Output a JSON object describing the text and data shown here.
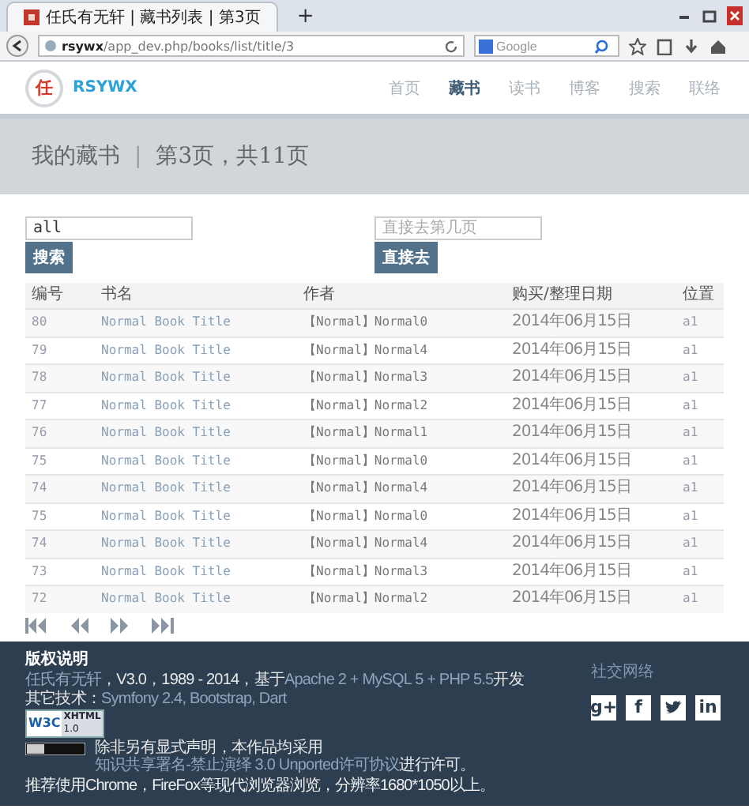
{
  "browser": {
    "tab_title": "任氏有无轩 | 藏书列表 | 第3页",
    "new_tab": "+",
    "url_host": "rsywx",
    "url_path": "/app_dev.php/books/list/title/3",
    "search_placeholder": "Google"
  },
  "nav": {
    "logo": "任",
    "brand": "RSYWX",
    "items": [
      {
        "label": "首页",
        "selected": false
      },
      {
        "label": "藏书",
        "selected": true
      },
      {
        "label": "读书",
        "selected": false
      },
      {
        "label": "博客",
        "selected": false
      },
      {
        "label": "搜索",
        "selected": false
      },
      {
        "label": "联络",
        "selected": false
      }
    ]
  },
  "banner": {
    "title": "我的藏书",
    "separator": "|",
    "subtitle": "第3页，共11页"
  },
  "search": {
    "value": "all",
    "button": "搜索"
  },
  "jump": {
    "placeholder": "直接去第几页",
    "button": "直接去"
  },
  "table": {
    "columns": [
      "编号",
      "书名",
      "作者",
      "购买/整理日期",
      "位置"
    ],
    "rows": [
      [
        "80",
        "Normal Book Title",
        "【Normal】Normal0",
        "2014年06月15日",
        "a1"
      ],
      [
        "79",
        "Normal Book Title",
        "【Normal】Normal4",
        "2014年06月15日",
        "a1"
      ],
      [
        "78",
        "Normal Book Title",
        "【Normal】Normal3",
        "2014年06月15日",
        "a1"
      ],
      [
        "77",
        "Normal Book Title",
        "【Normal】Normal2",
        "2014年06月15日",
        "a1"
      ],
      [
        "76",
        "Normal Book Title",
        "【Normal】Normal1",
        "2014年06月15日",
        "a1"
      ],
      [
        "75",
        "Normal Book Title",
        "【Normal】Normal0",
        "2014年06月15日",
        "a1"
      ],
      [
        "74",
        "Normal Book Title",
        "【Normal】Normal4",
        "2014年06月15日",
        "a1"
      ],
      [
        "75",
        "Normal Book Title",
        "【Normal】Normal0",
        "2014年06月15日",
        "a1"
      ],
      [
        "74",
        "Normal Book Title",
        "【Normal】Normal4",
        "2014年06月15日",
        "a1"
      ],
      [
        "73",
        "Normal Book Title",
        "【Normal】Normal3",
        "2014年06月15日",
        "a1"
      ],
      [
        "72",
        "Normal Book Title",
        "【Normal】Normal2",
        "2014年06月15日",
        "a1"
      ]
    ]
  },
  "footer": {
    "heading": "版权说明",
    "lines": [
      [
        {
          "text": "任氏有无轩",
          "link": true
        },
        {
          "text": "，V3.0，1989 - 2014，基于",
          "link": false
        },
        {
          "text": "Apache 2 + MySQL 5 + PHP 5.5",
          "link": true
        },
        {
          "text": "开发",
          "link": false
        }
      ],
      [
        {
          "text": "其它技术：",
          "link": false
        },
        {
          "text": "Symfony 2.4, Bootstrap, Dart",
          "link": true
        }
      ]
    ],
    "w3c": {
      "logo": "W3C",
      "label": "XHTML",
      "version": "1.0"
    },
    "license": [
      {
        "text": "除非另有显式声明，本作品均采用",
        "link": false
      },
      {
        "text": "知识共享署名-禁止演绎 3.0 Unported许可协议",
        "link": true
      },
      {
        "text": "进行许可。",
        "link": false
      }
    ],
    "note": "推荐使用Chrome，FireFox等现代浏览器浏览，分辨率1680*1050以上。",
    "social_heading": "社交网络",
    "social": [
      {
        "kind": "google",
        "label": "g+"
      },
      {
        "kind": "facebook",
        "label": "f"
      },
      {
        "kind": "twitter"
      },
      {
        "kind": "linkedin",
        "label": "in"
      }
    ]
  }
}
